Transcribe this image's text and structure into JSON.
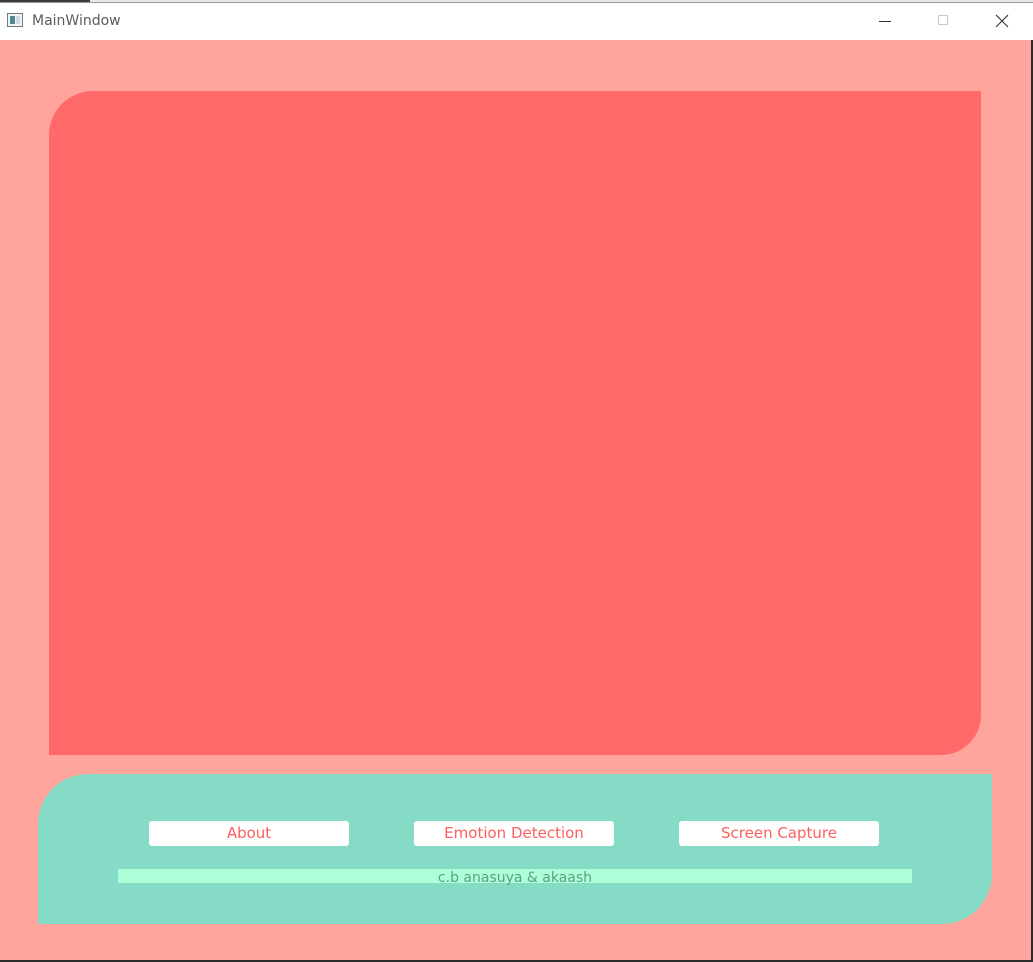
{
  "window": {
    "title": "MainWindow",
    "icon": "app-window-icon"
  },
  "controls": {
    "minimize_icon": "minimize-icon",
    "maximize_icon": "maximize-icon",
    "close_icon": "close-icon"
  },
  "buttons": {
    "about": "About",
    "emotion_detection": "Emotion Detection",
    "screen_capture": "Screen Capture"
  },
  "footer": {
    "credit": "c.b anasuya & akaash"
  },
  "colors": {
    "background": "#ffa59d",
    "video_panel": "#ff6969",
    "bottom_panel": "#86dbc6",
    "credit_bar": "#acffd8",
    "button_text": "#ff5e5e"
  }
}
